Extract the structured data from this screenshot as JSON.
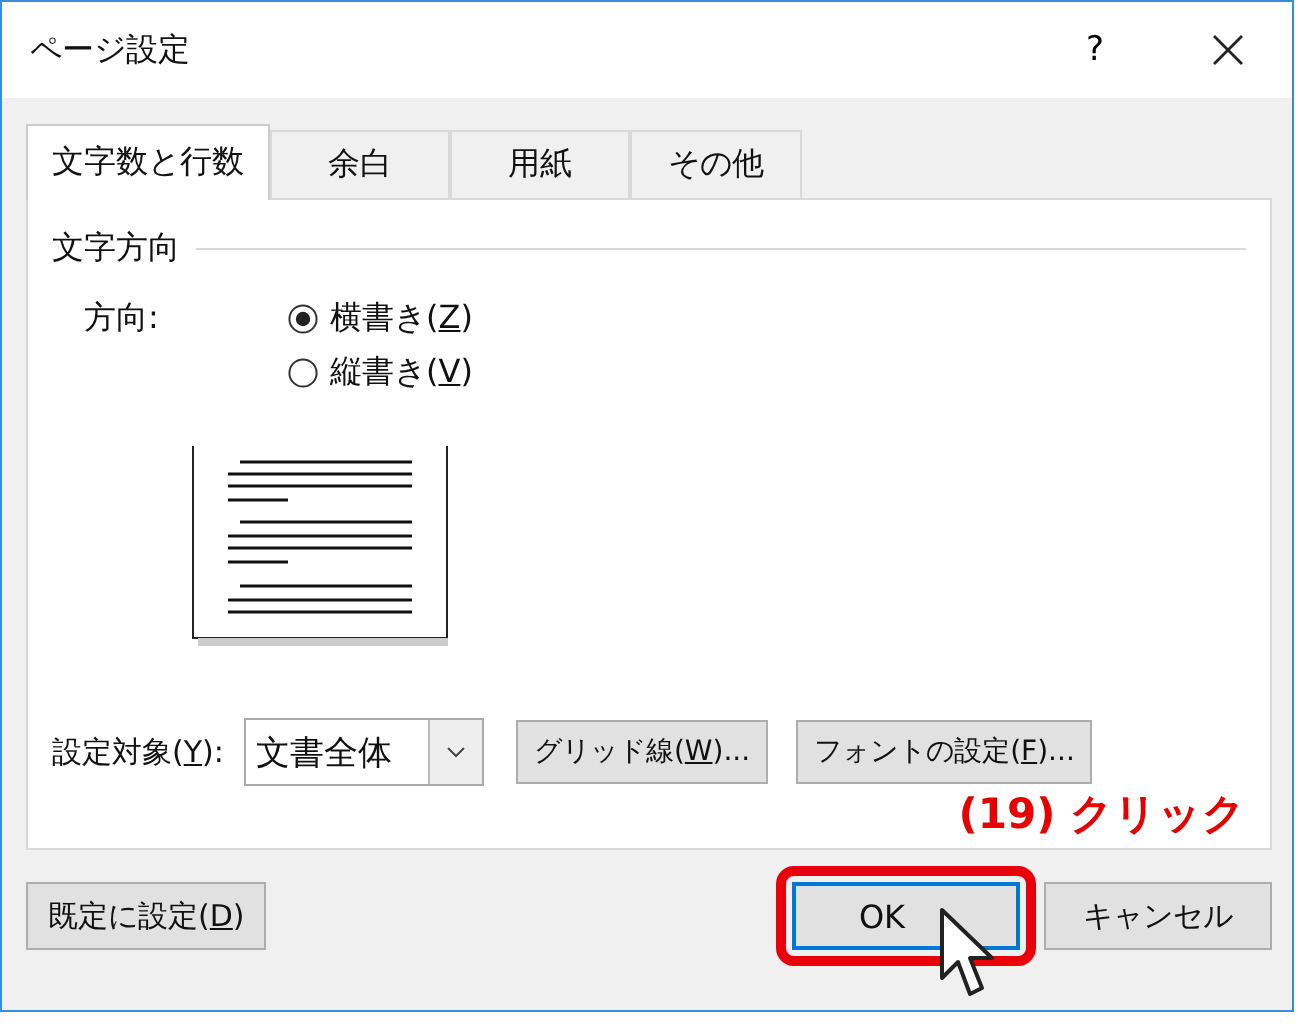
{
  "window": {
    "title": "ページ設定",
    "help": "?"
  },
  "tabs": [
    {
      "label": "文字数と行数",
      "selected": true
    },
    {
      "label": "余白",
      "selected": false
    },
    {
      "label": "用紙",
      "selected": false
    },
    {
      "label": "その他",
      "selected": false
    }
  ],
  "text_direction": {
    "heading": "文字方向",
    "label": "方向:",
    "options": [
      {
        "label": "横書き(Z)",
        "selected": true
      },
      {
        "label": "縦書き(V)",
        "selected": false
      }
    ]
  },
  "apply_to": {
    "label": "設定対象(Y):",
    "value": "文書全体"
  },
  "panel_buttons": [
    "グリッド線(W)...",
    "フォントの設定(F)..."
  ],
  "annotation": "(19) クリック",
  "footer": {
    "default_button": "既定に設定(D)",
    "ok_button": "OK",
    "cancel_button": "キャンセル"
  }
}
